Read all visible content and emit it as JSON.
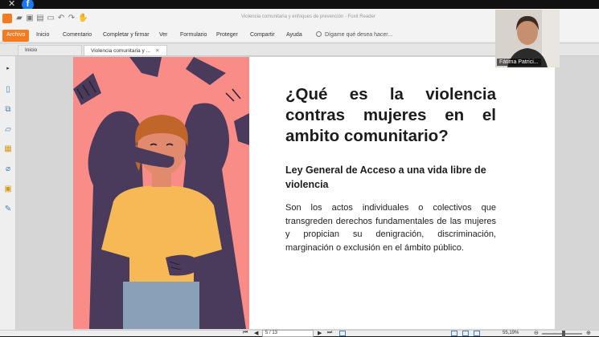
{
  "overlay": {
    "close_glyph": "✕",
    "facebook_letter": "f"
  },
  "window": {
    "title": "Violencia comunitaria y enfoques de prevención - Foxit Reader"
  },
  "menu": {
    "items": [
      "Archivo",
      "Inicio",
      "Comentario",
      "Completar y firmar",
      "Ver",
      "Formulario",
      "Proteger",
      "Compartir",
      "Ayuda"
    ],
    "help_placeholder": "Dígame qué desea hacer..."
  },
  "tabs": [
    {
      "label": "Inicio"
    },
    {
      "label": "Violencia comunitaria y ...",
      "close": "✕"
    }
  ],
  "slide": {
    "title": "¿Qué es la violencia contras mujeres en el ambito comunitario?",
    "subtitle": "Ley General de Acceso a una vida libre de violencia",
    "body": "Son los actos individuales o colectivos que transgreden derechos fundamentales de las mujeres y propician su denigración, discriminación, marginación o exclusión en el ámbito público."
  },
  "status": {
    "page_indicator": "5 / 13",
    "zoom": "55,19%",
    "zoom_fraction": 0.55
  },
  "webcam": {
    "participant_name": "Fátima Patrici..."
  },
  "watermark": "zoom",
  "colors": {
    "accent": "#f47b20",
    "illustration_bg": "#fa8c88",
    "shadow_figure": "#4a3a5c",
    "shirt": "#f6b955"
  }
}
